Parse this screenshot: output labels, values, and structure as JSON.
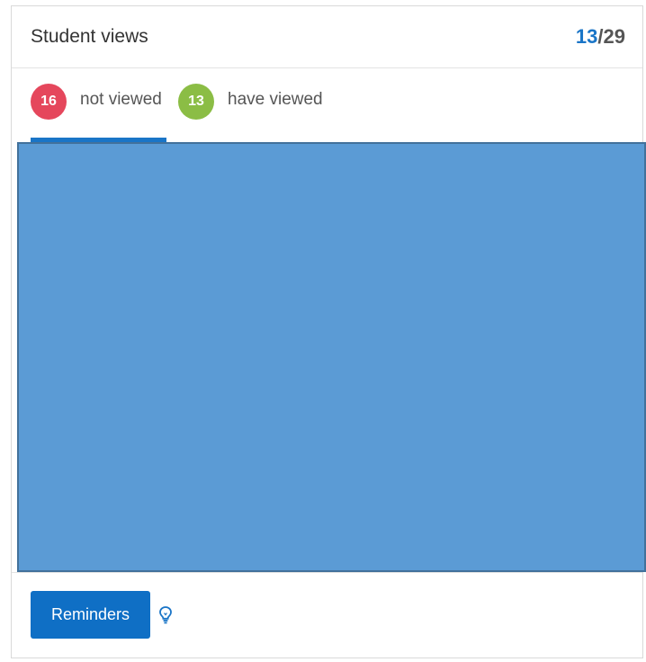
{
  "card": {
    "title": "Student views",
    "count": {
      "viewed": "13",
      "separator": "/",
      "total": "29"
    }
  },
  "tabs": [
    {
      "count": "16",
      "label": "not viewed",
      "badge_color": "#e5475c",
      "active": true
    },
    {
      "count": "13",
      "label": "have viewed",
      "badge_color": "#8bbd45",
      "active": false
    }
  ],
  "footer": {
    "reminders_label": "Reminders",
    "hint_icon": "lightbulb-icon"
  },
  "colors": {
    "accent": "#1a75c7",
    "content_panel": "#5b9bd5"
  }
}
